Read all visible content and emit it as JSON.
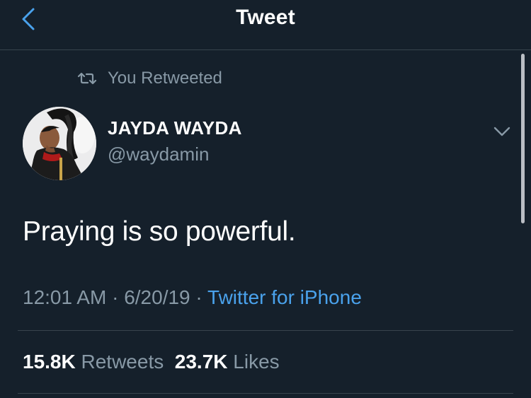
{
  "nav": {
    "title": "Tweet",
    "back_icon": "chevron-left-icon"
  },
  "retweet_context": {
    "icon": "retweet-icon",
    "label": "You Retweeted"
  },
  "author": {
    "name": "JAYDA WAYDA",
    "handle": "@waydamin"
  },
  "tweet": {
    "text": "Praying is so powerful."
  },
  "meta": {
    "time": "12:01 AM",
    "sep1": " · ",
    "date": "6/20/19",
    "sep2": " · ",
    "source": "Twitter for iPhone"
  },
  "stats": {
    "retweets_count": "15.8K",
    "retweets_label": "Retweets",
    "likes_count": "23.7K",
    "likes_label": "Likes"
  },
  "colors": {
    "background": "#15202b",
    "accent": "#4aa2ec",
    "secondary_text": "#8899a6",
    "divider": "#38444d"
  }
}
